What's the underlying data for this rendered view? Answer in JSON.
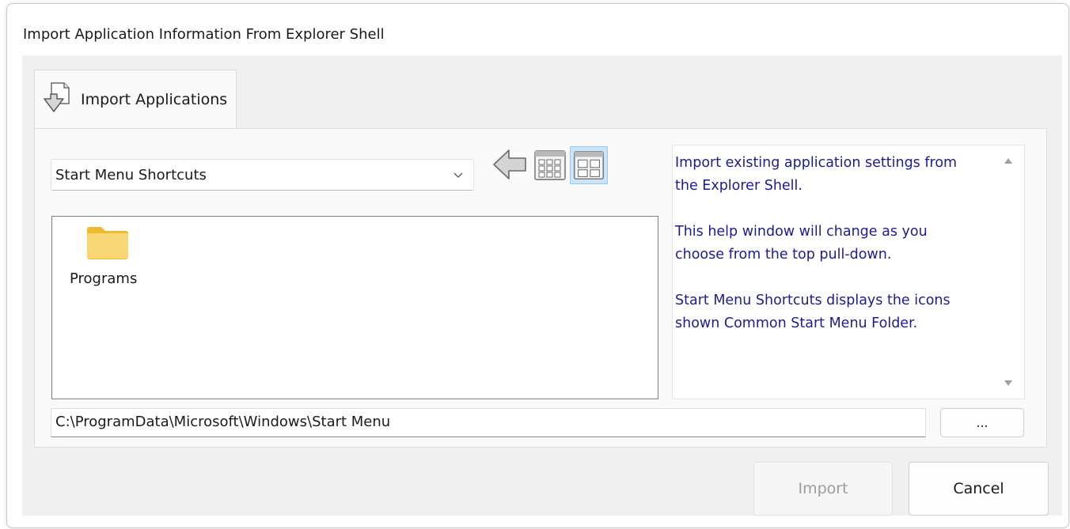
{
  "window": {
    "title": "Import Application Information From Explorer Shell"
  },
  "tab": {
    "label": "Import Applications",
    "icon": "import-document-icon"
  },
  "source_select": {
    "value": "Start Menu Shortcuts"
  },
  "toolbar": {
    "back_icon": "back-arrow-icon",
    "small_icons_view": "small-icons-view-icon",
    "large_icons_view": "large-icons-view-icon",
    "active_view": "large"
  },
  "file_view": {
    "items": [
      {
        "label": "Programs",
        "icon": "folder-icon"
      }
    ]
  },
  "help": {
    "text": "Import existing application settings from\nthe Explorer Shell.\n\nThis help window will change as you\nchoose from the top pull-down.\n\nStart Menu Shortcuts displays the icons\nshown Common Start Menu Folder."
  },
  "path": {
    "value": "C:\\ProgramData\\Microsoft\\Windows\\Start Menu"
  },
  "buttons": {
    "browse": "...",
    "import": "Import",
    "cancel": "Cancel"
  },
  "colors": {
    "help_text": "#1b1b99",
    "dialog_bg": "#f0f0f0",
    "selected_view_bg": "#cce4f7",
    "folder": "#f8d775"
  }
}
